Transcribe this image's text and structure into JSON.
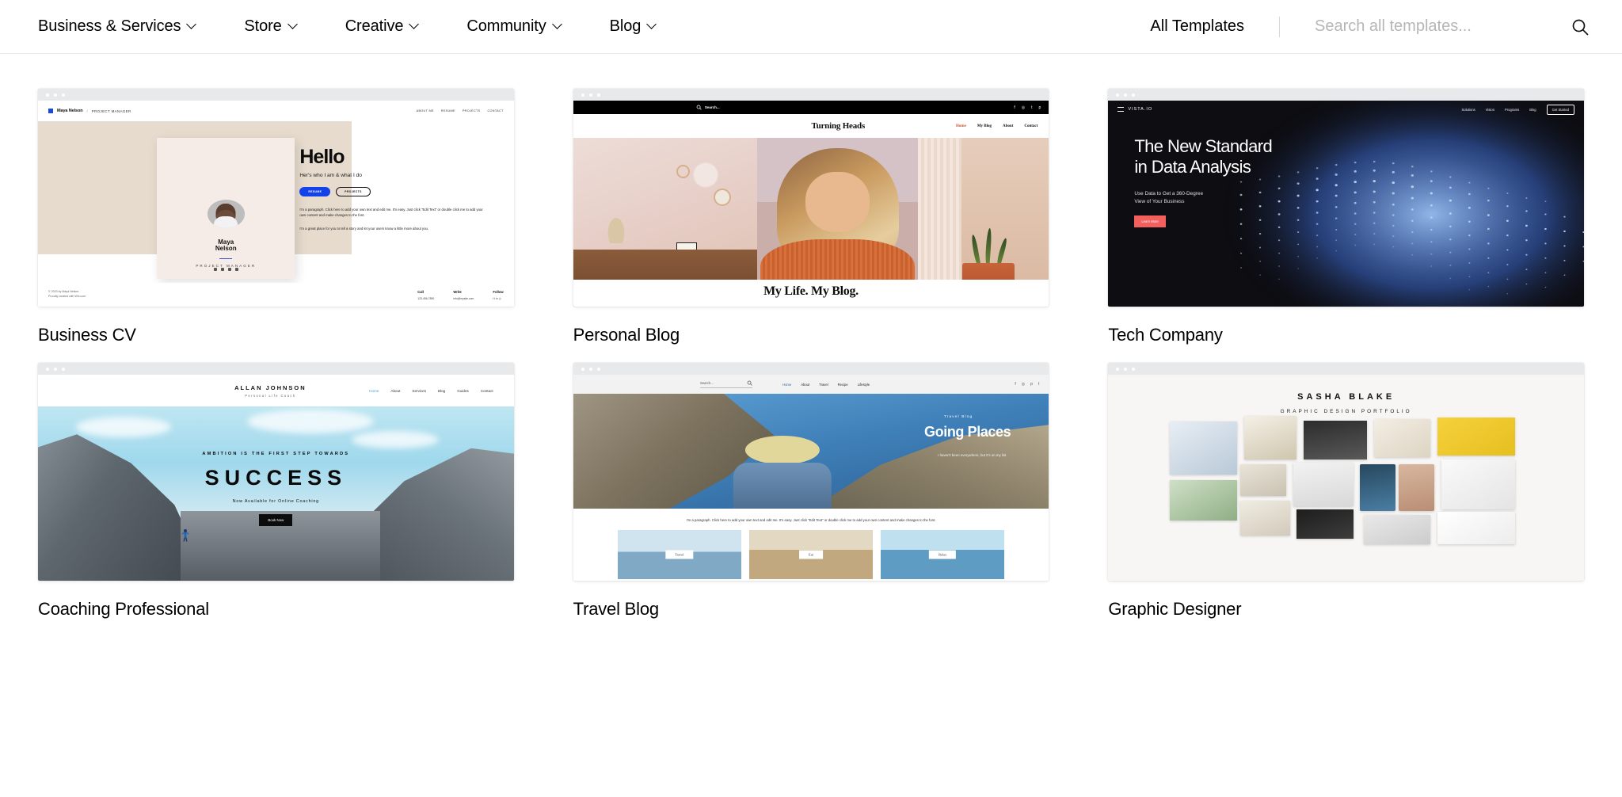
{
  "nav": {
    "items": [
      {
        "label": "Business & Services",
        "has_chevron": true
      },
      {
        "label": "Store",
        "has_chevron": true
      },
      {
        "label": "Creative",
        "has_chevron": true
      },
      {
        "label": "Community",
        "has_chevron": true
      },
      {
        "label": "Blog",
        "has_chevron": true
      }
    ],
    "all_templates": "All Templates",
    "search_placeholder": "Search all templates...",
    "search_value": "",
    "search_icon": "search-icon"
  },
  "gallery": {
    "cards": [
      {
        "title": "Business CV",
        "preview": {
          "brand": "Maya Nelson",
          "slash": "/",
          "role": "PROJECT MANAGER",
          "links": [
            "ABOUT ME",
            "RESUME",
            "PROJECTS",
            "CONTACT"
          ],
          "card_name": "Maya\nNelson",
          "card_role": "PROJECT MANAGER",
          "headline": "Hello",
          "subhead": "Her's who I am & what I do",
          "btn_primary": "RESUME",
          "btn_secondary": "PROJECTS",
          "para1": "I'm a paragraph. Click here to add your own text and edit me. It's easy. Just click “Edit Text” or double click me to add your own content and make changes to the font.",
          "para2": "I'm a great place for you to tell a story and let your users know a little more about you.",
          "copyright": "© 2023 by Maya Nelson.\nProudly created with Wix.com",
          "footer_cols": [
            {
              "title": "Call",
              "value": "123-456-7890"
            },
            {
              "title": "Write",
              "value": "info@mysite.com"
            },
            {
              "title": "Follow",
              "value": "f t in ◎"
            }
          ]
        }
      },
      {
        "title": "Personal Blog",
        "preview": {
          "search": "Search...",
          "logo": "Turning Heads",
          "links": [
            "Home",
            "My Blog",
            "About",
            "Contact"
          ],
          "active_link": "Home",
          "socials": [
            "f",
            "◎",
            "t",
            "p"
          ],
          "hero_title": "My Life. My Blog."
        }
      },
      {
        "title": "Tech Company",
        "preview": {
          "logo": "VISTA.IO",
          "links": [
            "Solutions",
            "Vision",
            "Programs",
            "Blog"
          ],
          "cta": "Get Started",
          "headline_line1": "The New Standard",
          "headline_line2": "in Data Analysis",
          "sub_line1": "Use Data to Get a 360-Degree",
          "sub_line2": "View of Your Business",
          "button": "Learn More",
          "accent_color": "#f25f5c",
          "background_color": "#0d0d12"
        }
      },
      {
        "title": "Coaching Professional",
        "preview": {
          "brand": "ALLAN JOHNSON",
          "brand_sub": "Personal Life Coach",
          "links": [
            "Home",
            "About",
            "Services",
            "Blog",
            "Guides",
            "Contact"
          ],
          "active_link": "Home",
          "kicker": "AMBITION IS THE FIRST STEP TOWARDS",
          "headline": "SUCCESS",
          "subhead": "Now Available for Online Coaching",
          "button": "Book Now"
        }
      },
      {
        "title": "Travel Blog",
        "preview": {
          "search": "Search...",
          "links": [
            "Home",
            "About",
            "Travel",
            "Recipe",
            "Lifestyle"
          ],
          "active_link": "Home",
          "socials": [
            "f",
            "◎",
            "p",
            "t"
          ],
          "kicker": "Travel Blog",
          "headline": "Going Places",
          "sub": "I haven't been everywhere, but it's on my list",
          "para": "I'm a paragraph. Click here to add your own text and edit me. It's easy. Just click “Edit Text” or double click me to add your own content and make changes to the font.",
          "cards": [
            "Travel",
            "Eat",
            "Relax"
          ]
        }
      },
      {
        "title": "Graphic Designer",
        "preview": {
          "name": "SASHA BLAKE",
          "subtitle": "GRAPHIC DESIGN PORTFOLIO"
        }
      }
    ]
  }
}
